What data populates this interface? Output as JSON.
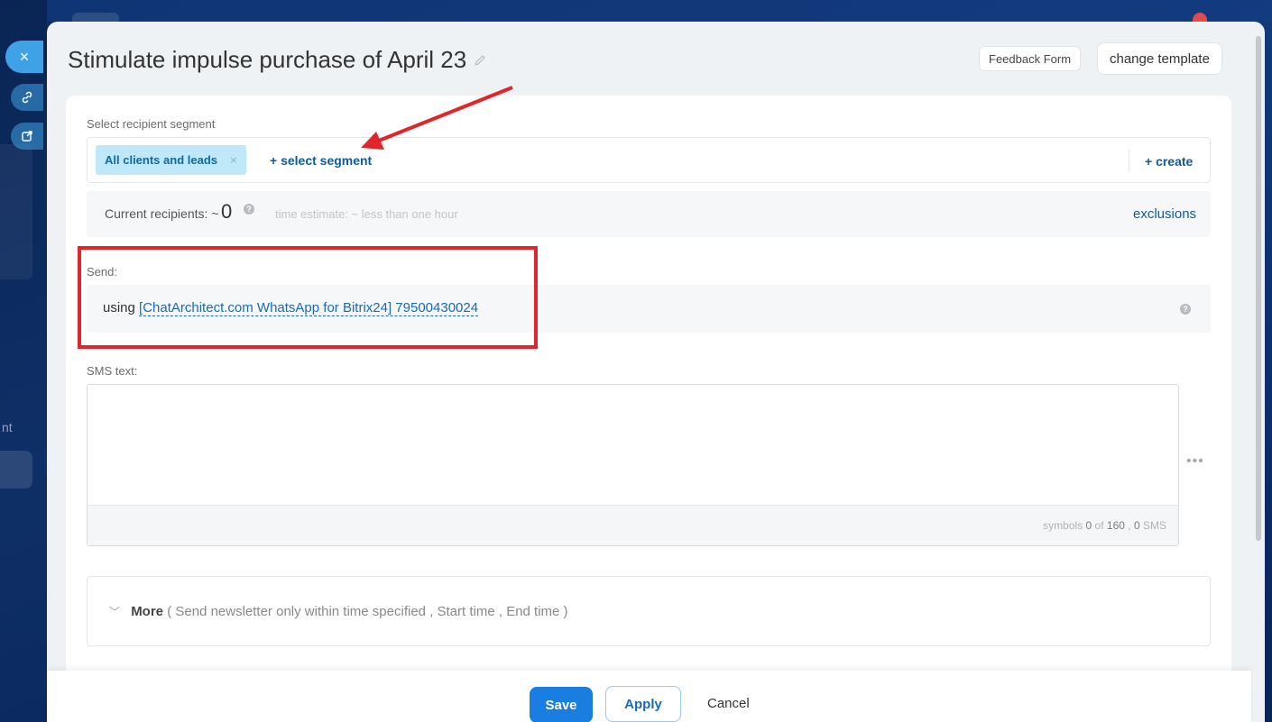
{
  "background": {
    "ghost_text": "nt"
  },
  "side_buttons": {
    "close_icon": "×",
    "link_icon": "🔗",
    "external_icon": "↗"
  },
  "header": {
    "title": "Stimulate impulse purchase of April 23",
    "feedback_label": "Feedback Form",
    "template_label": "change template"
  },
  "segment": {
    "label": "Select recipient segment",
    "tag": "All clients and leads",
    "tag_remove": "×",
    "select_label": "+ select segment",
    "create_label": "+ create"
  },
  "recipients": {
    "label": "Current recipients: ~",
    "count": "0",
    "estimate": "time estimate: ~ less than one hour",
    "exclusions": "exclusions"
  },
  "send": {
    "label": "Send:",
    "prefix": "using",
    "channel": "[ChatArchitect.com WhatsApp for Bitrix24] 79500430024"
  },
  "sms": {
    "label": "SMS text:",
    "text": "",
    "counter_prefix": "symbols",
    "symbols": "0",
    "counter_of": "of",
    "limit": "160",
    "sms_count": "0",
    "sms_suffix": "SMS",
    "more_dots": "•••"
  },
  "more": {
    "label": "More",
    "details": "( Send newsletter only within time specified ,  Start time ,  End time )"
  },
  "footer": {
    "save": "Save",
    "apply": "Apply",
    "cancel": "Cancel"
  },
  "colors": {
    "primary": "#1a7ee0",
    "link": "#0f5a9c",
    "tag_bg": "#bfe8f8",
    "annotation": "#e0262a"
  }
}
